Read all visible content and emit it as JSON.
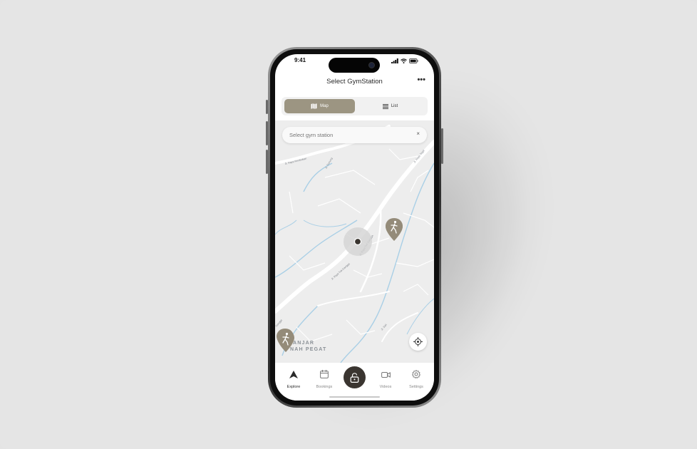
{
  "status_bar": {
    "time": "9:41"
  },
  "header": {
    "title": "Select GymStation",
    "more_label": "•••"
  },
  "view_toggle": {
    "map_label": "Map",
    "list_label": "List",
    "selected": "Map"
  },
  "search": {
    "placeholder": "Select gym station",
    "clear_label": "×"
  },
  "map": {
    "place_label_line1": "ANJAR",
    "place_label_line2": "NAH PEGAT",
    "street_labels": [
      "Jl. Raya Kerobokan",
      "Jl. Gunung",
      "Jl. Raya Tegal",
      "Jl. Raya Tuk Gangga",
      "Jl. Raya Tuk Gangga",
      "Jl. Sari",
      "Gangga"
    ]
  },
  "tabs": [
    {
      "label": "Explore",
      "icon": "explore-icon",
      "active": true
    },
    {
      "label": "Bookings",
      "icon": "calendar-icon",
      "active": false
    },
    {
      "label": "Videos",
      "icon": "video-icon",
      "active": false
    },
    {
      "label": "Settings",
      "icon": "gear-icon",
      "active": false
    }
  ],
  "center_action": {
    "icon": "unlock-icon"
  },
  "colors": {
    "accent": "#9c9582",
    "dark": "#3a3530",
    "water": "#a9cfe6",
    "pin": "#948b79"
  }
}
